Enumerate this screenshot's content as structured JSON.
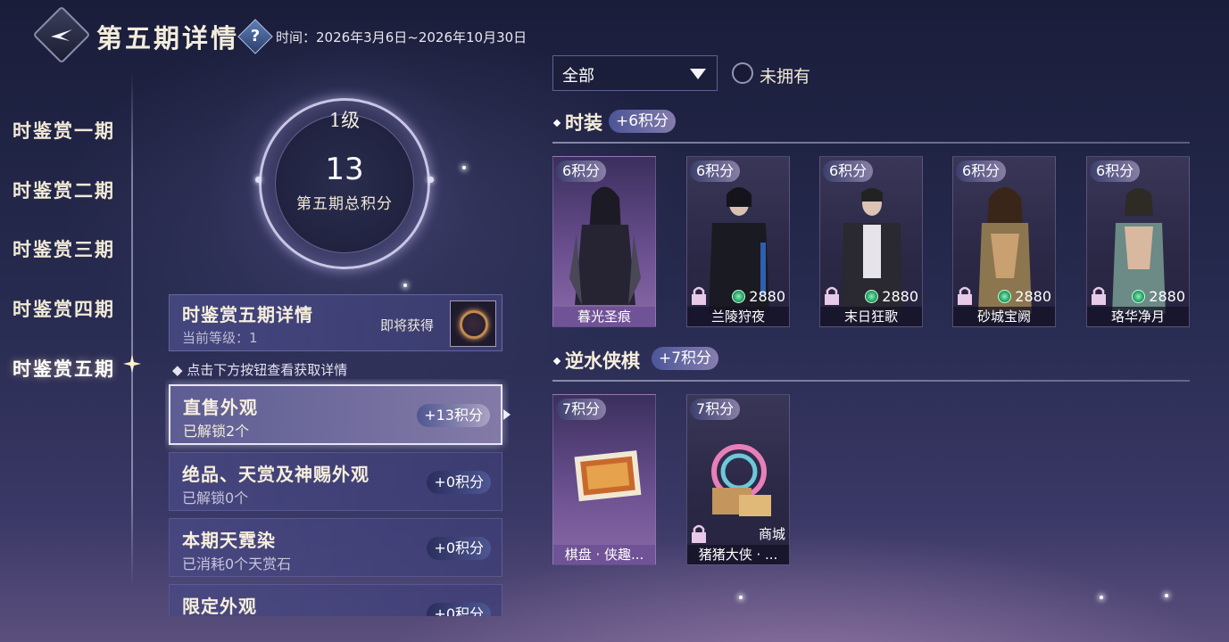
{
  "header": {
    "title": "第五期详情",
    "time_text": "时间：2026年3月6日~2026年10月30日"
  },
  "sidebar": {
    "items": [
      {
        "label": "时鉴赏一期"
      },
      {
        "label": "时鉴赏二期"
      },
      {
        "label": "时鉴赏三期"
      },
      {
        "label": "时鉴赏四期"
      },
      {
        "label": "时鉴赏五期"
      }
    ],
    "active_index": 4
  },
  "ring": {
    "level": "1级",
    "total": "13",
    "label": "第五期总积分"
  },
  "detail": {
    "title": "时鉴赏五期详情",
    "current_level": "当前等级：1",
    "soon_label": "即将获得"
  },
  "hint": "◆ 点击下方按钮查看获取详情",
  "categories": [
    {
      "title": "直售外观",
      "sub": "已解锁2个",
      "points": "+13积分"
    },
    {
      "title": "绝品、天赏及神赐外观",
      "sub": "已解锁0个",
      "points": "+0积分"
    },
    {
      "title": "本期天霓染",
      "sub": "已消耗0个天赏石",
      "points": "+0积分"
    },
    {
      "title": "限定外观",
      "sub": "",
      "points": "+0积分"
    }
  ],
  "filter": {
    "selected": "全部",
    "not_owned_label": "未拥有"
  },
  "sections": [
    {
      "title": "时装",
      "points": "+6积分",
      "items": [
        {
          "points": "6积分",
          "name": "暮光圣痕",
          "price": "",
          "locked": false,
          "owned_style": true
        },
        {
          "points": "6积分",
          "name": "兰陵狩夜",
          "price": "2880",
          "locked": true,
          "owned_style": false
        },
        {
          "points": "6积分",
          "name": "末日狂歌",
          "price": "2880",
          "locked": true,
          "owned_style": false
        },
        {
          "points": "6积分",
          "name": "砂城宝阙",
          "price": "2880",
          "locked": true,
          "owned_style": false
        },
        {
          "points": "6积分",
          "name": "珞华净月",
          "price": "2880",
          "locked": true,
          "owned_style": false
        }
      ]
    },
    {
      "title": "逆水侠棋",
      "points": "+7积分",
      "items": [
        {
          "points": "7积分",
          "name": "棋盘 · 侠趣...",
          "shop": "",
          "locked": false,
          "owned_style": true
        },
        {
          "points": "7积分",
          "name": "猪猪大侠 · ...",
          "shop": "商城",
          "locked": true,
          "owned_style": false
        }
      ]
    }
  ],
  "colors": {
    "accent_gold": "#f2ecdc",
    "coin_green": "#23a066",
    "owned_purple": "#8b6aa8"
  }
}
